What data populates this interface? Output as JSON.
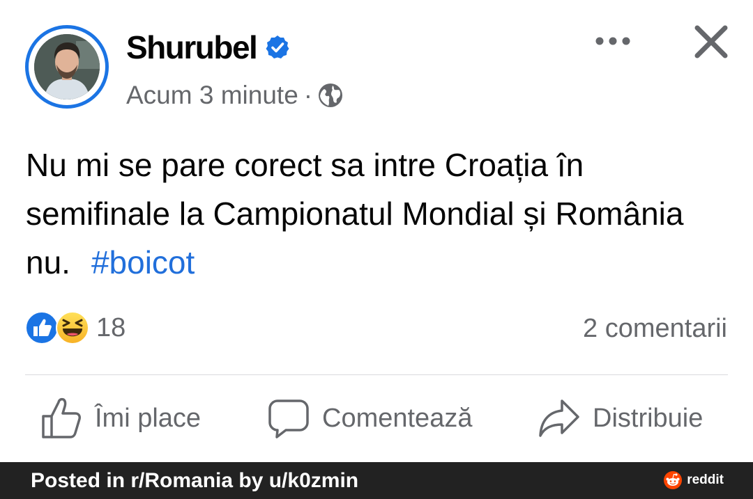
{
  "post": {
    "author": "Shurubel",
    "timestamp": "Acum 3 minute",
    "separator": "·",
    "text": "Nu mi se pare corect sa intre Croația în semifinale la Campionatul Mondial și România nu.",
    "hashtag": "#boicot",
    "reaction_count": "18",
    "comments_count": "2 comentarii",
    "icons": [
      "verified-badge-icon",
      "globe-icon",
      "more-options-icon",
      "close-icon",
      "like-reaction-icon",
      "haha-reaction-icon"
    ]
  },
  "actions": {
    "like_label": "Îmi place",
    "comment_label": "Comentează",
    "share_label": "Distribuie",
    "icons": [
      "thumbs-up-icon",
      "comment-bubble-icon",
      "share-arrow-icon"
    ]
  },
  "footer": {
    "caption": "Posted in r/Romania by u/k0zmin",
    "brand": "reddit"
  },
  "colors": {
    "accent_blue": "#1b74e4",
    "hashtag_blue": "#216fdb",
    "secondary_text": "#65676b",
    "footer_bg": "#222222",
    "reddit_orange": "#ff4500"
  }
}
